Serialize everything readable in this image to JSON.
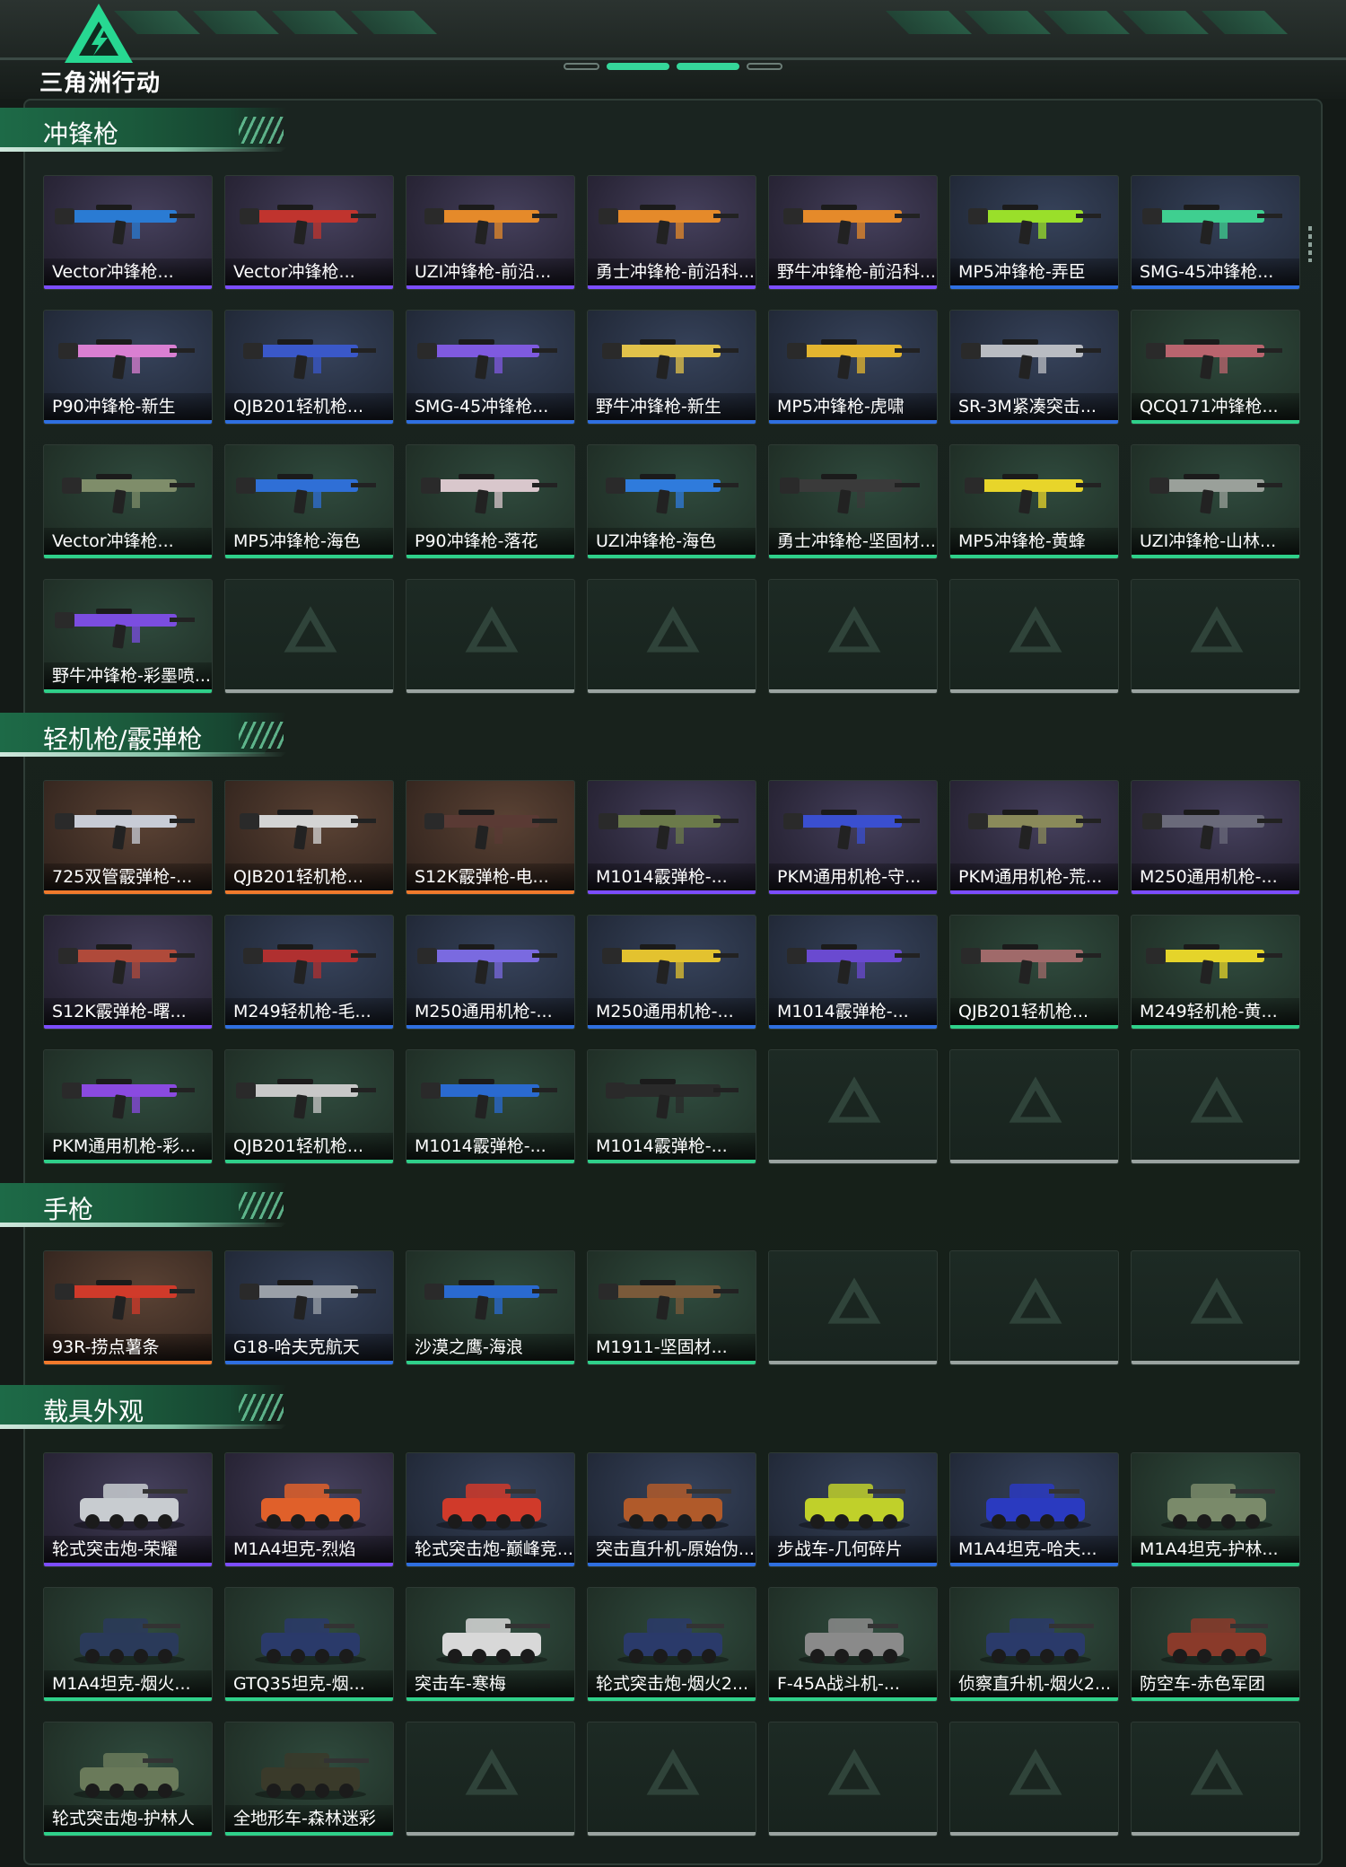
{
  "header": {
    "logo_text": "三角洲行动"
  },
  "sections": [
    {
      "title": "冲锋枪",
      "items": [
        {
          "label": "Vector冲锋枪...",
          "rarity": "purple",
          "color": "#2a7bd3"
        },
        {
          "label": "Vector冲锋枪...",
          "rarity": "purple",
          "color": "#c0342e"
        },
        {
          "label": "UZI冲锋枪-前沿...",
          "rarity": "purple",
          "color": "#e58a2a"
        },
        {
          "label": "勇士冲锋枪-前沿科...",
          "rarity": "purple",
          "color": "#e58a2a"
        },
        {
          "label": "野牛冲锋枪-前沿科...",
          "rarity": "purple",
          "color": "#e58a2a"
        },
        {
          "label": "MP5冲锋枪-弄臣",
          "rarity": "blue",
          "color": "#9adf2a"
        },
        {
          "label": "SMG-45冲锋枪...",
          "rarity": "blue",
          "color": "#3fcf90"
        },
        {
          "label": "P90冲锋枪-新生",
          "rarity": "blue",
          "color": "#d97fd2"
        },
        {
          "label": "QJB201轻机枪...",
          "rarity": "blue",
          "color": "#3a58c9"
        },
        {
          "label": "SMG-45冲锋枪...",
          "rarity": "blue",
          "color": "#7f5ae0"
        },
        {
          "label": "野牛冲锋枪-新生",
          "rarity": "blue",
          "color": "#e1c24a"
        },
        {
          "label": "MP5冲锋枪-虎啸",
          "rarity": "blue",
          "color": "#e3b52f"
        },
        {
          "label": "SR-3M紧凑突击...",
          "rarity": "blue",
          "color": "#b9bcc2"
        },
        {
          "label": "QCQ171冲锋枪...",
          "rarity": "green",
          "color": "#b9646e"
        },
        {
          "label": "Vector冲锋枪...",
          "rarity": "green",
          "color": "#7f8d6a"
        },
        {
          "label": "MP5冲锋枪-海色",
          "rarity": "green",
          "color": "#2f6fd6"
        },
        {
          "label": "P90冲锋枪-落花",
          "rarity": "green",
          "color": "#d9c7cc"
        },
        {
          "label": "UZI冲锋枪-海色",
          "rarity": "green",
          "color": "#2f7bdc"
        },
        {
          "label": "勇士冲锋枪-坚固材...",
          "rarity": "green",
          "color": "#3a3a3a"
        },
        {
          "label": "MP5冲锋枪-黄蜂",
          "rarity": "green",
          "color": "#e8d52a"
        },
        {
          "label": "UZI冲锋枪-山林...",
          "rarity": "green",
          "color": "#9aa09a"
        },
        {
          "label": "野牛冲锋枪-彩墨喷...",
          "rarity": "green",
          "color": "#7b4de0"
        },
        {
          "empty": true
        },
        {
          "empty": true
        },
        {
          "empty": true
        },
        {
          "empty": true
        },
        {
          "empty": true
        },
        {
          "empty": true
        }
      ]
    },
    {
      "title": "轻机枪/霰弹枪",
      "items": [
        {
          "label": "725双管霰弹枪-...",
          "rarity": "orange",
          "color": "#c8ccd6"
        },
        {
          "label": "QJB201轻机枪...",
          "rarity": "orange",
          "color": "#d4d4d4"
        },
        {
          "label": "S12K霰弹枪-电...",
          "rarity": "orange",
          "color": "#5a3a34"
        },
        {
          "label": "M1014霰弹枪-...",
          "rarity": "purple",
          "color": "#6b7a4a"
        },
        {
          "label": "PKM通用机枪-守...",
          "rarity": "purple",
          "color": "#3a4fd0"
        },
        {
          "label": "PKM通用机枪-荒...",
          "rarity": "purple",
          "color": "#8a8a5a"
        },
        {
          "label": "M250通用机枪-...",
          "rarity": "purple",
          "color": "#6a6a7a"
        },
        {
          "label": "S12K霰弹枪-曙...",
          "rarity": "purple",
          "color": "#b04a3a"
        },
        {
          "label": "M249轻机枪-毛...",
          "rarity": "blue",
          "color": "#b03030"
        },
        {
          "label": "M250通用机枪-...",
          "rarity": "blue",
          "color": "#7a6ae0"
        },
        {
          "label": "M250通用机枪-...",
          "rarity": "blue",
          "color": "#e3c22f"
        },
        {
          "label": "M1014霰弹枪-...",
          "rarity": "blue",
          "color": "#6a4ad0"
        },
        {
          "label": "QJB201轻机枪...",
          "rarity": "green",
          "color": "#a06a6a"
        },
        {
          "label": "M249轻机枪-黄...",
          "rarity": "green",
          "color": "#e5d42a"
        },
        {
          "label": "PKM通用机枪-彩...",
          "rarity": "green",
          "color": "#8a4ae0"
        },
        {
          "label": "QJB201轻机枪...",
          "rarity": "green",
          "color": "#c8c8c8"
        },
        {
          "label": "M1014霰弹枪-...",
          "rarity": "green",
          "color": "#2a6ad0"
        },
        {
          "label": "M1014霰弹枪-...",
          "rarity": "green",
          "color": "#2a2a2a"
        },
        {
          "empty": true
        },
        {
          "empty": true
        },
        {
          "empty": true
        }
      ]
    },
    {
      "title": "手枪",
      "items": [
        {
          "label": "93R-捞点薯条",
          "rarity": "orange",
          "color": "#d03a2a"
        },
        {
          "label": "G18-哈夫克航天",
          "rarity": "blue",
          "color": "#9aa0a8"
        },
        {
          "label": "沙漠之鹰-海浪",
          "rarity": "green",
          "color": "#2a6ad0"
        },
        {
          "label": "M1911-坚固材...",
          "rarity": "green",
          "color": "#7a5a3a"
        },
        {
          "empty": true
        },
        {
          "empty": true
        },
        {
          "empty": true
        }
      ]
    },
    {
      "title": "载具外观",
      "items": [
        {
          "label": "轮式突击炮-荣耀",
          "rarity": "purple",
          "color": "#c8ccd0"
        },
        {
          "label": "M1A4坦克-烈焰",
          "rarity": "purple",
          "color": "#e0602a"
        },
        {
          "label": "轮式突击炮-巅峰竞...",
          "rarity": "blue",
          "color": "#d03a2a"
        },
        {
          "label": "突击直升机-原始伪...",
          "rarity": "blue",
          "color": "#b05a2a"
        },
        {
          "label": "步战车-几何碎片",
          "rarity": "blue",
          "color": "#c0d02a"
        },
        {
          "label": "M1A4坦克-哈夫...",
          "rarity": "blue",
          "color": "#2a3ac0"
        },
        {
          "label": "M1A4坦克-护林...",
          "rarity": "green",
          "color": "#7a8a6a"
        },
        {
          "label": "M1A4坦克-烟火...",
          "rarity": "green",
          "color": "#2a3a5a"
        },
        {
          "label": "GTQ35坦克-烟...",
          "rarity": "green",
          "color": "#2a3a6a"
        },
        {
          "label": "突击车-寒梅",
          "rarity": "green",
          "color": "#d8d8d8"
        },
        {
          "label": "轮式突击炮-烟火2...",
          "rarity": "green",
          "color": "#2a3a6a"
        },
        {
          "label": "F-45A战斗机-...",
          "rarity": "green",
          "color": "#8a8a8a"
        },
        {
          "label": "侦察直升机-烟火2...",
          "rarity": "green",
          "color": "#2a3a6a"
        },
        {
          "label": "防空车-赤色军团",
          "rarity": "green",
          "color": "#8a3a2a"
        },
        {
          "label": "轮式突击炮-护林人",
          "rarity": "green",
          "color": "#6a7a5a"
        },
        {
          "label": "全地形车-森林迷彩",
          "rarity": "green",
          "color": "#3a3a2a"
        },
        {
          "empty": true
        },
        {
          "empty": true
        },
        {
          "empty": true
        },
        {
          "empty": true
        },
        {
          "empty": true
        }
      ]
    }
  ]
}
